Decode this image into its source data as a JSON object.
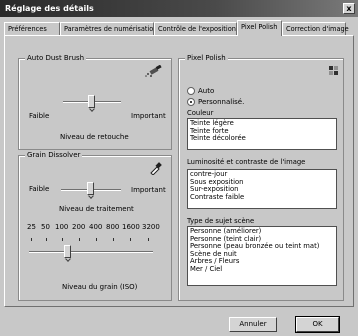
{
  "window": {
    "title": "Réglage des détails",
    "close_label": "x"
  },
  "tabs": [
    {
      "label": "Préférences"
    },
    {
      "label": "Paramètres de numérisation"
    },
    {
      "label": "Contrôle de l'exposition"
    },
    {
      "label": "Pixel Polish"
    },
    {
      "label": "Correction d'image"
    }
  ],
  "active_tab": "Pixel Polish",
  "dust": {
    "title": "Auto Dust Brush",
    "icon": "brush-dust-icon",
    "left_label": "Faible",
    "right_label": "Important",
    "caption": "Niveau de retouche",
    "level": 0.5
  },
  "grain": {
    "title": "Grain Dissolver",
    "icon": "dropper-icon",
    "left_label": "Faible",
    "right_label": "Important",
    "caption": "Niveau de traitement",
    "level": 0.5,
    "iso_ticks": [
      "25",
      "50",
      "100",
      "200",
      "400",
      "800",
      "1600",
      "3200"
    ],
    "iso_caption": "Niveau du grain (ISO)",
    "iso_selected": "100"
  },
  "pixel": {
    "title": "Pixel Polish",
    "icon": "grid-icon",
    "auto_label": "Auto",
    "custom_label": "Personnalisé.",
    "selected_mode": "custom",
    "color_header": "Couleur",
    "color_items": [
      "Teinte légère",
      "Teinte forte",
      "Teinte décolorée"
    ],
    "light_header": "Luminosité et contraste de l'image",
    "light_items": [
      "contre-jour",
      "Sous exposition",
      "Sur-exposition",
      "Contraste faible"
    ],
    "subject_header": "Type de sujet  scène",
    "subject_items": [
      "Personne (améliorer)",
      "Personne (teint clair)",
      "Personne (peau bronzée ou teint mat)",
      "Scène de nuit",
      "Arbres / Fleurs",
      "Mer / Ciel"
    ]
  },
  "buttons": {
    "cancel": "Annuler",
    "ok": "OK"
  }
}
